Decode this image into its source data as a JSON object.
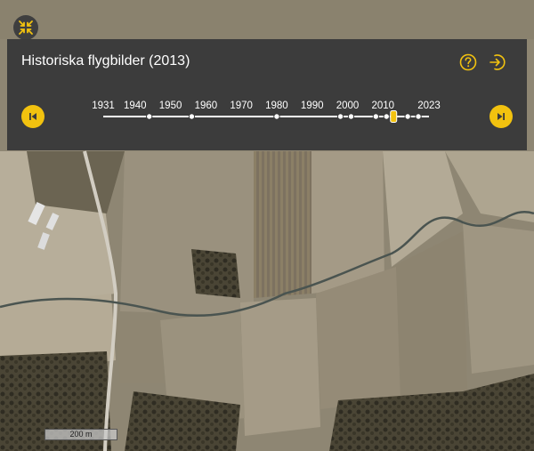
{
  "panel": {
    "title": "Historiska flygbilder (2013)"
  },
  "icons": {
    "collapse": "collapse-arrows-icon",
    "help": "question-mark-icon",
    "exit": "exit-arrow-icon",
    "prev": "skip-back-icon",
    "next": "skip-forward-icon"
  },
  "colors": {
    "accent": "#f2c20f",
    "panel_bg": "#3a3a3a"
  },
  "timeline": {
    "start_year": 1931,
    "end_year": 2023,
    "selected_year": 2013,
    "labels": [
      "1931",
      "1940",
      "1950",
      "1960",
      "1970",
      "1980",
      "1990",
      "2000",
      "2010",
      "2023"
    ],
    "image_years": [
      1944,
      1956,
      1980,
      1998,
      2001,
      2008,
      2011,
      2013,
      2017,
      2020
    ]
  },
  "scale": {
    "label": "200 m"
  }
}
